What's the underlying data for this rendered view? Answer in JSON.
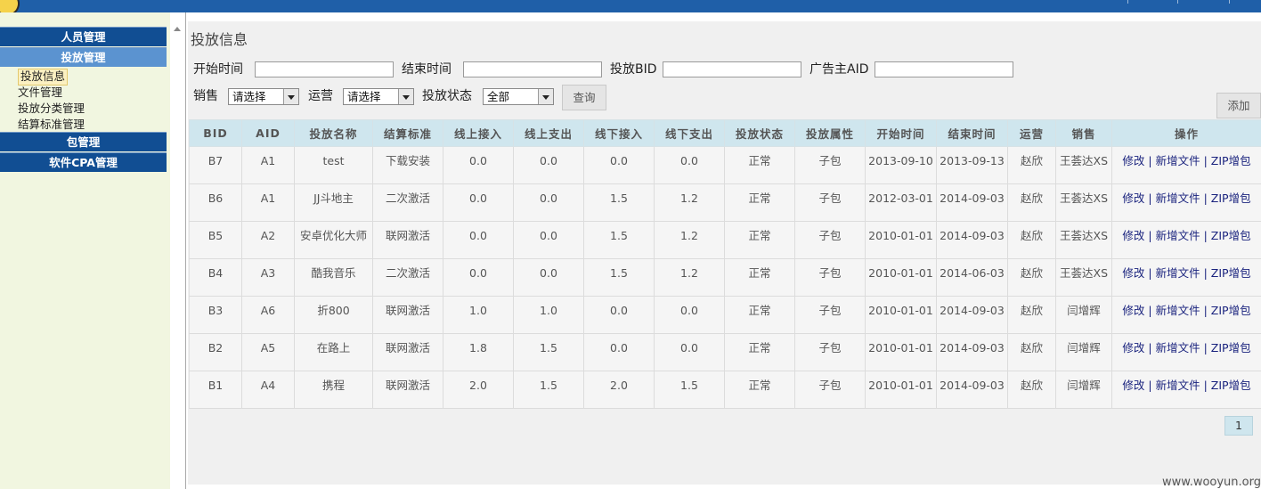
{
  "sidebar": {
    "sections": [
      {
        "label": "人员管理"
      },
      {
        "label": "投放管理"
      },
      {
        "label": "包管理"
      },
      {
        "label": "软件CPA管理"
      }
    ],
    "items": [
      {
        "label": "投放信息"
      },
      {
        "label": "文件管理"
      },
      {
        "label": "投放分类管理"
      },
      {
        "label": "结算标准管理"
      }
    ]
  },
  "page": {
    "title": "投放信息"
  },
  "filters": {
    "start_time_label": "开始时间",
    "end_time_label": "结束时间",
    "bid_label": "投放BID",
    "aid_label": "广告主AID",
    "sales_label": "销售",
    "sales_value": "请选择",
    "ops_label": "运营",
    "ops_value": "请选择",
    "status_label": "投放状态",
    "status_value": "全部",
    "query_button": "查询",
    "add_button": "添加"
  },
  "table": {
    "headers": [
      "BID",
      "AID",
      "投放名称",
      "结算标准",
      "线上接入",
      "线上支出",
      "线下接入",
      "线下支出",
      "投放状态",
      "投放属性",
      "开始时间",
      "结束时间",
      "运营",
      "销售",
      "操作"
    ],
    "rows": [
      {
        "bid": "B7",
        "aid": "A1",
        "name": "test",
        "settle": "下载安装",
        "on_in": "0.0",
        "on_out": "0.0",
        "off_in": "0.0",
        "off_out": "0.0",
        "status": "正常",
        "attr": "子包",
        "start": "2013-09-10",
        "end": "2013-09-13",
        "ops": "赵欣",
        "sales": "王荟达XS"
      },
      {
        "bid": "B6",
        "aid": "A1",
        "name": "JJ斗地主",
        "settle": "二次激活",
        "on_in": "0.0",
        "on_out": "0.0",
        "off_in": "1.5",
        "off_out": "1.2",
        "status": "正常",
        "attr": "子包",
        "start": "2012-03-01",
        "end": "2014-09-03",
        "ops": "赵欣",
        "sales": "王荟达XS"
      },
      {
        "bid": "B5",
        "aid": "A2",
        "name": "安卓优化大师",
        "settle": "联网激活",
        "on_in": "0.0",
        "on_out": "0.0",
        "off_in": "1.5",
        "off_out": "1.2",
        "status": "正常",
        "attr": "子包",
        "start": "2010-01-01",
        "end": "2014-09-03",
        "ops": "赵欣",
        "sales": "王荟达XS"
      },
      {
        "bid": "B4",
        "aid": "A3",
        "name": "酷我音乐",
        "settle": "二次激活",
        "on_in": "0.0",
        "on_out": "0.0",
        "off_in": "1.5",
        "off_out": "1.2",
        "status": "正常",
        "attr": "子包",
        "start": "2010-01-01",
        "end": "2014-06-03",
        "ops": "赵欣",
        "sales": "王荟达XS"
      },
      {
        "bid": "B3",
        "aid": "A6",
        "name": "折800",
        "settle": "联网激活",
        "on_in": "1.0",
        "on_out": "1.0",
        "off_in": "0.0",
        "off_out": "0.0",
        "status": "正常",
        "attr": "子包",
        "start": "2010-01-01",
        "end": "2014-09-03",
        "ops": "赵欣",
        "sales": "闫增辉"
      },
      {
        "bid": "B2",
        "aid": "A5",
        "name": "在路上",
        "settle": "联网激活",
        "on_in": "1.8",
        "on_out": "1.5",
        "off_in": "0.0",
        "off_out": "0.0",
        "status": "正常",
        "attr": "子包",
        "start": "2010-01-01",
        "end": "2014-09-03",
        "ops": "赵欣",
        "sales": "闫增辉"
      },
      {
        "bid": "B1",
        "aid": "A4",
        "name": "携程",
        "settle": "联网激活",
        "on_in": "2.0",
        "on_out": "1.5",
        "off_in": "2.0",
        "off_out": "1.5",
        "status": "正常",
        "attr": "子包",
        "start": "2010-01-01",
        "end": "2014-09-03",
        "ops": "赵欣",
        "sales": "闫增辉"
      }
    ],
    "actions": {
      "edit": "修改",
      "add_file": "新增文件",
      "zip": "ZIP增包",
      "sep": "|"
    }
  },
  "pagination": {
    "current": "1"
  },
  "watermark": "www.wooyun.org"
}
